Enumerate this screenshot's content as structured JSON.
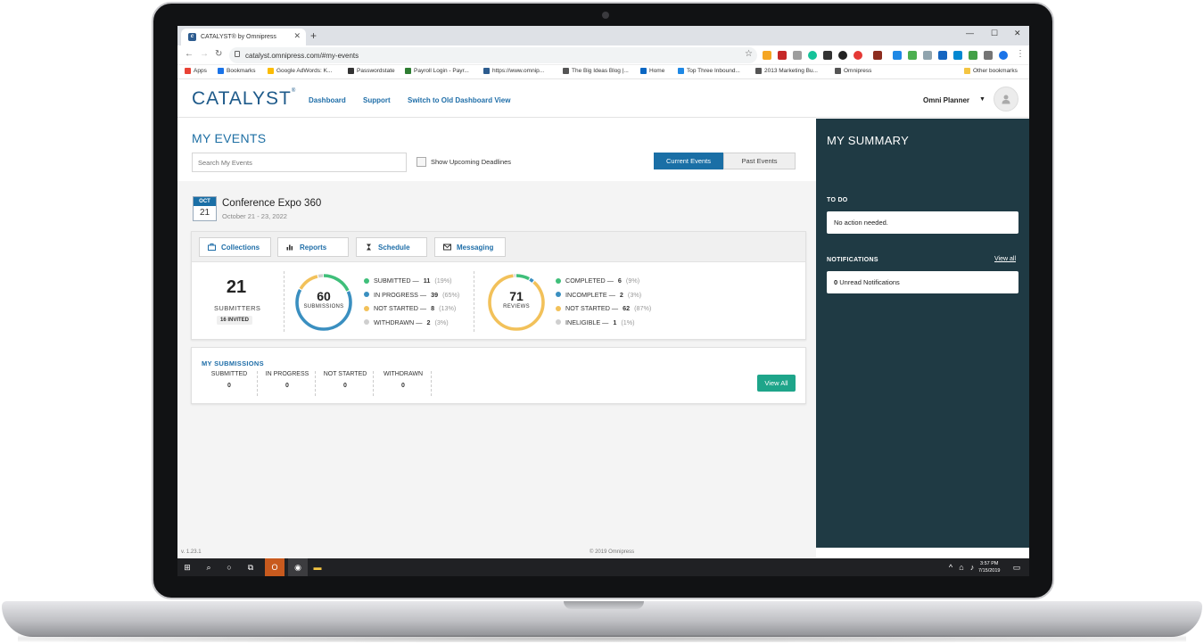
{
  "browser": {
    "tab_title": "CATALYST® by Omnipress",
    "url": "catalyst.omnipress.com/#my-events",
    "bookmarks": [
      {
        "label": "Apps",
        "color": "#e94235"
      },
      {
        "label": "Bookmarks",
        "color": "#1a73e8"
      },
      {
        "label": "Google AdWords: K...",
        "color": "#fbbc04"
      },
      {
        "label": "Passwordstate",
        "color": "#333333"
      },
      {
        "label": "Payroll Login - Payr...",
        "color": "#2e7d32"
      },
      {
        "label": "https://www.omnip...",
        "color": "#2d5c8f"
      },
      {
        "label": "The Big Ideas Blog |...",
        "color": "#555555"
      },
      {
        "label": "Home",
        "color": "#0a66c2"
      },
      {
        "label": "Top Three Inbound...",
        "color": "#1e88e5"
      },
      {
        "label": "2013 Marketing Bu...",
        "color": "#555555"
      },
      {
        "label": "Omnipress",
        "color": "#555555"
      },
      {
        "label": "Other bookmarks",
        "color": "#f4c542"
      }
    ]
  },
  "header": {
    "logo": "CATALYST",
    "logo_mark": "®",
    "nav": [
      "Dashboard",
      "Support",
      "Switch to Old Dashboard View"
    ],
    "user": "Omni Planner"
  },
  "main": {
    "title": "MY EVENTS",
    "search_placeholder": "Search My Events",
    "deadlines_label": "Show Upcoming Deadlines",
    "toggle": [
      "Current Events",
      "Past Events"
    ]
  },
  "event": {
    "month": "OCT",
    "day": "21",
    "title": "Conference Expo 360",
    "dates": "October 21 - 23, 2022",
    "tabs": [
      "Collections",
      "Reports",
      "Schedule",
      "Messaging"
    ],
    "submitters": {
      "count": "21",
      "label": "SUBMITTERS",
      "invited": "16 INVITED"
    },
    "submissions": {
      "total": "60",
      "label": "SUBMISSIONS",
      "items": [
        {
          "label": "SUBMITTED —",
          "count": "11",
          "pct": "(19%)",
          "value": 11,
          "color": "#3fbf7a"
        },
        {
          "label": "IN PROGRESS —",
          "count": "39",
          "pct": "(65%)",
          "value": 39,
          "color": "#3a8fc0"
        },
        {
          "label": "NOT STARTED —",
          "count": "8",
          "pct": "(13%)",
          "value": 8,
          "color": "#f2c15a"
        },
        {
          "label": "WITHDRAWN —",
          "count": "2",
          "pct": "(3%)",
          "value": 2,
          "color": "#cfcfcf"
        }
      ]
    },
    "reviews": {
      "total": "71",
      "label": "REVIEWS",
      "items": [
        {
          "label": "COMPLETED —",
          "count": "6",
          "pct": "(9%)",
          "value": 6,
          "color": "#3fbf7a"
        },
        {
          "label": "INCOMPLETE —",
          "count": "2",
          "pct": "(3%)",
          "value": 2,
          "color": "#3a8fc0"
        },
        {
          "label": "NOT STARTED —",
          "count": "62",
          "pct": "(87%)",
          "value": 62,
          "color": "#f2c15a"
        },
        {
          "label": "INELIGIBLE —",
          "count": "1",
          "pct": "(1%)",
          "value": 1,
          "color": "#cfcfcf"
        }
      ]
    }
  },
  "my_submissions": {
    "title": "MY SUBMISSIONS",
    "columns": [
      {
        "label": "SUBMITTED",
        "value": "0"
      },
      {
        "label": "IN PROGRESS",
        "value": "0"
      },
      {
        "label": "NOT STARTED",
        "value": "0"
      },
      {
        "label": "WITHDRAWN",
        "value": "0"
      }
    ],
    "view_all": "View All"
  },
  "summary": {
    "title": "MY SUMMARY",
    "todo_label": "TO DO",
    "todo_text": "No action needed.",
    "notifications_label": "NOTIFICATIONS",
    "view_all": "View all",
    "unread_count": "0",
    "unread_text": "Unread Notifications"
  },
  "footer": {
    "version": "v. 1.23.1",
    "copyright": "© 2019 Omnipress"
  },
  "taskbar": {
    "time": "3:57 PM",
    "date": "7/15/2019"
  }
}
